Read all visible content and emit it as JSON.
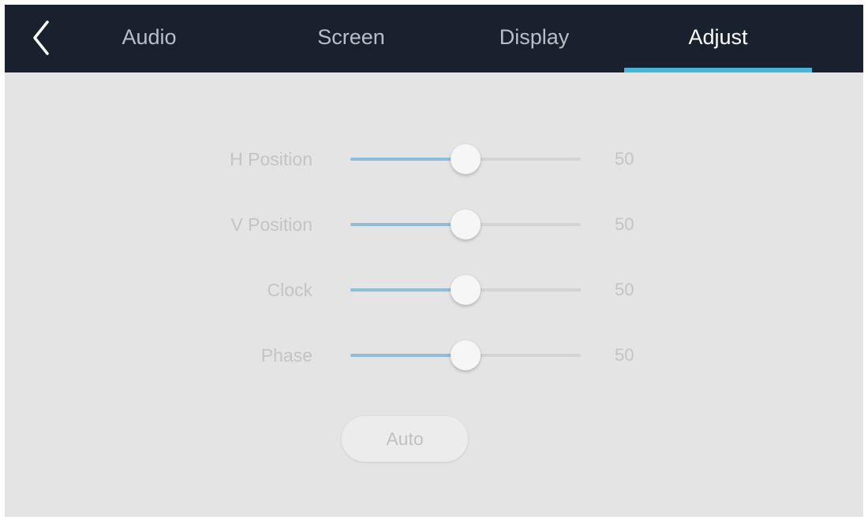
{
  "nav": {
    "back_icon": "chevron-left-icon",
    "tabs": [
      {
        "label": "Audio",
        "active": false
      },
      {
        "label": "Screen",
        "active": false
      },
      {
        "label": "Display",
        "active": false
      },
      {
        "label": "Adjust",
        "active": true
      }
    ]
  },
  "adjust": {
    "sliders": [
      {
        "label": "H Position",
        "value": "50",
        "level": 0.5
      },
      {
        "label": "V Position",
        "value": "50",
        "level": 0.5
      },
      {
        "label": "Clock",
        "value": "50",
        "level": 0.5
      },
      {
        "label": "Phase",
        "value": "50",
        "level": 0.5
      }
    ],
    "auto_label": "Auto"
  },
  "colors": {
    "header_bg": "#18212d",
    "content_bg": "#e4e4e4",
    "accent": "#46b5d9",
    "slider_fill": "#8fbcd8"
  }
}
